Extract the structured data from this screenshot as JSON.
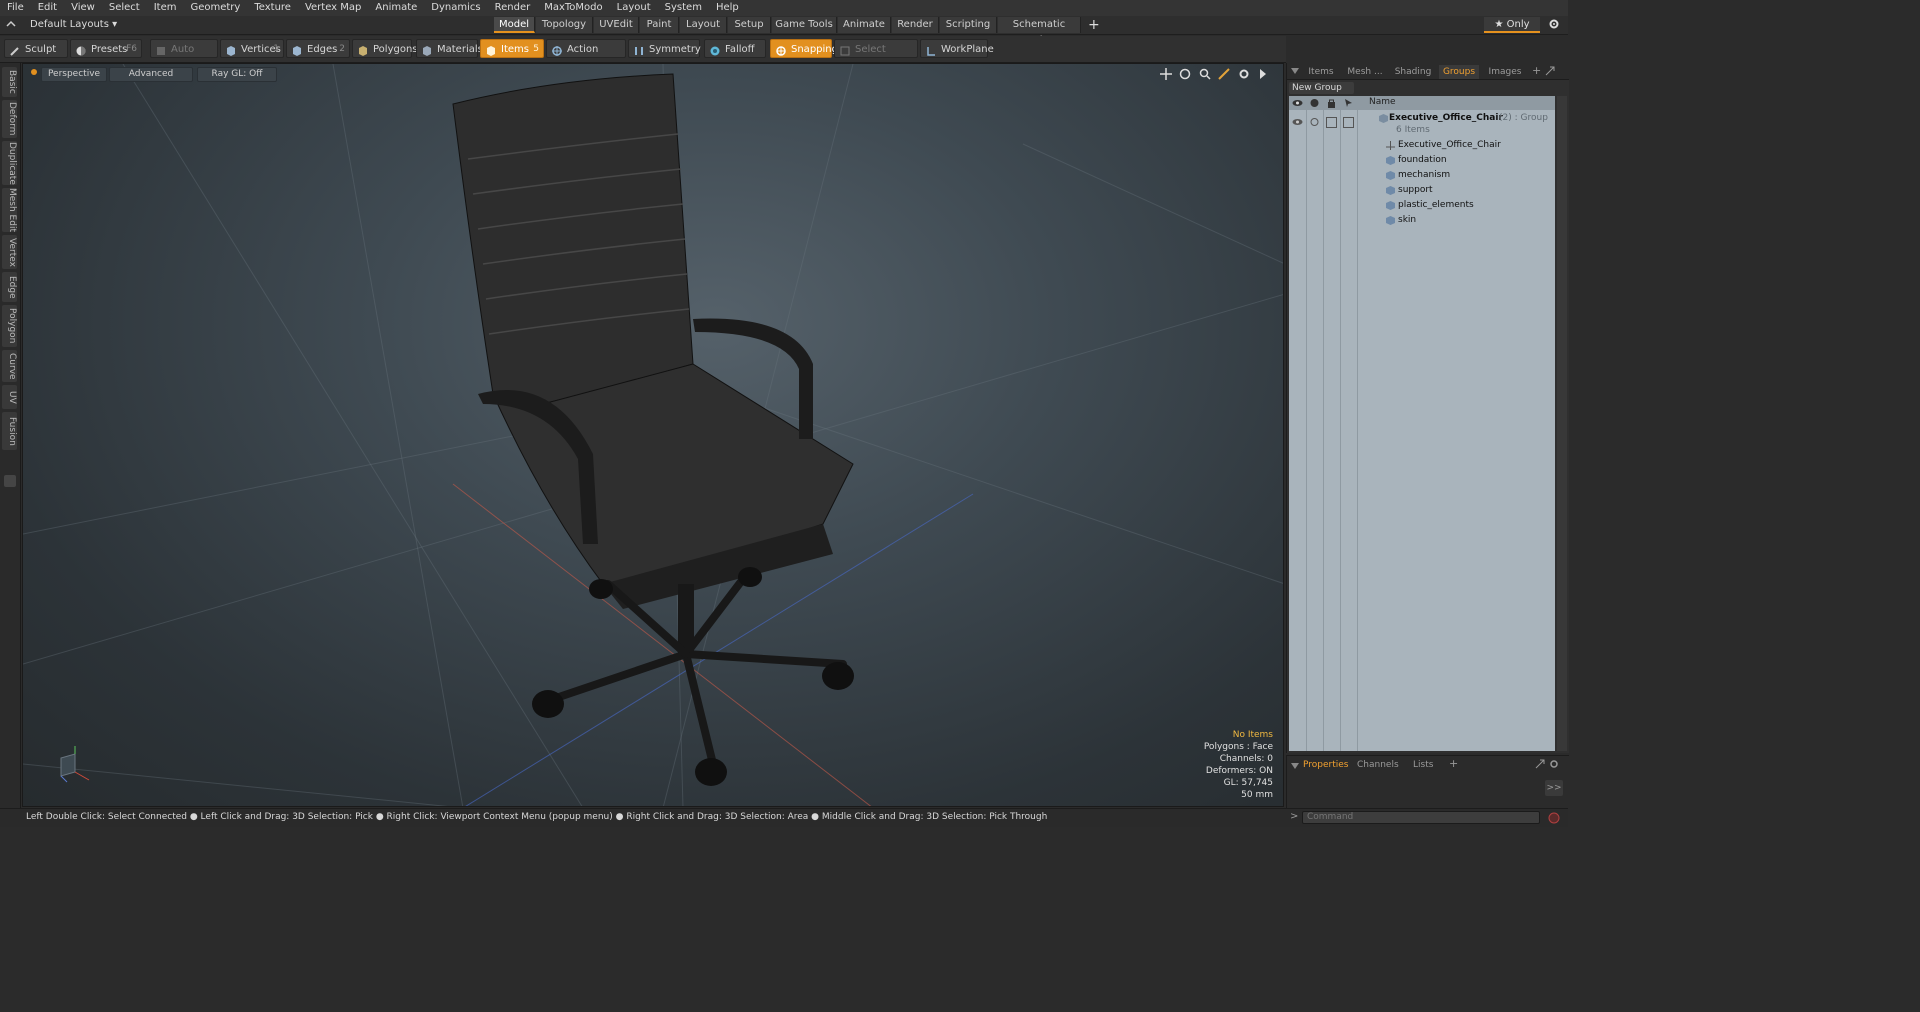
{
  "menu": [
    "File",
    "Edit",
    "View",
    "Select",
    "Item",
    "Geometry",
    "Texture",
    "Vertex Map",
    "Animate",
    "Dynamics",
    "Render",
    "MaxToModo",
    "Layout",
    "System",
    "Help"
  ],
  "layouts_label": "Default Layouts ▾",
  "mode_tabs": [
    "Model",
    "Topology",
    "UVEdit",
    "Paint",
    "Layout",
    "Setup",
    "Game Tools",
    "Animate",
    "Render",
    "Scripting",
    "Schematic Fusion"
  ],
  "active_tab": "Model",
  "only_label": "★  Only",
  "toolbar": {
    "sculpt": "Sculpt",
    "presets": "Presets",
    "presets_key": "F6",
    "auto_select": "Auto Select",
    "vertices": "Vertices",
    "vertices_count": "1",
    "edges": "Edges",
    "edges_count": "2",
    "polygons": "Polygons",
    "materials": "Materials",
    "items": "Items",
    "items_count": "5",
    "action_center": "Action Center",
    "symmetry": "Symmetry",
    "falloff": "Falloff",
    "snapping": "Snapping",
    "select_through": "Select Through",
    "workplane": "WorkPlane"
  },
  "left_tabs": [
    "Basic",
    "Deform",
    "Duplicate",
    "Mesh Edit",
    "Vertex",
    "Edge",
    "Polygon",
    "Curve",
    "UV",
    "Fusion"
  ],
  "viewport": {
    "view": "Perspective",
    "mode": "Advanced",
    "raygl": "Ray GL: Off",
    "info": {
      "no_items": "No Items",
      "polygons": "Polygons : Face",
      "channels": "Channels: 0",
      "deformers": "Deformers: ON",
      "gl": "GL: 57,745",
      "lens": "50 mm"
    }
  },
  "right_panel": {
    "tabs": [
      "Items",
      "Mesh ...",
      "Shading",
      "Groups",
      "Images"
    ],
    "active_tab": "Groups",
    "new_group": "New Group",
    "column_name": "Name",
    "group": {
      "name": "Executive_Office_Chair",
      "suffix": " (2) : Group",
      "count": "6 Items"
    },
    "items": [
      "Executive_Office_Chair",
      "foundation",
      "mechanism",
      "support",
      "plastic_elements",
      "skin"
    ],
    "bottom_tabs": [
      "Properties",
      "Channels",
      "Lists"
    ],
    "command_placeholder": "Command"
  },
  "status": "Left Double Click: Select Connected ● Left Click and Drag: 3D Selection: Pick ● Right Click: Viewport Context Menu (popup menu) ● Right Click and Drag: 3D Selection: Area ● Middle Click and Drag: 3D Selection: Pick Through",
  "colors": {
    "accent": "#e2901f",
    "tree_bg": "#a9b4bc"
  }
}
